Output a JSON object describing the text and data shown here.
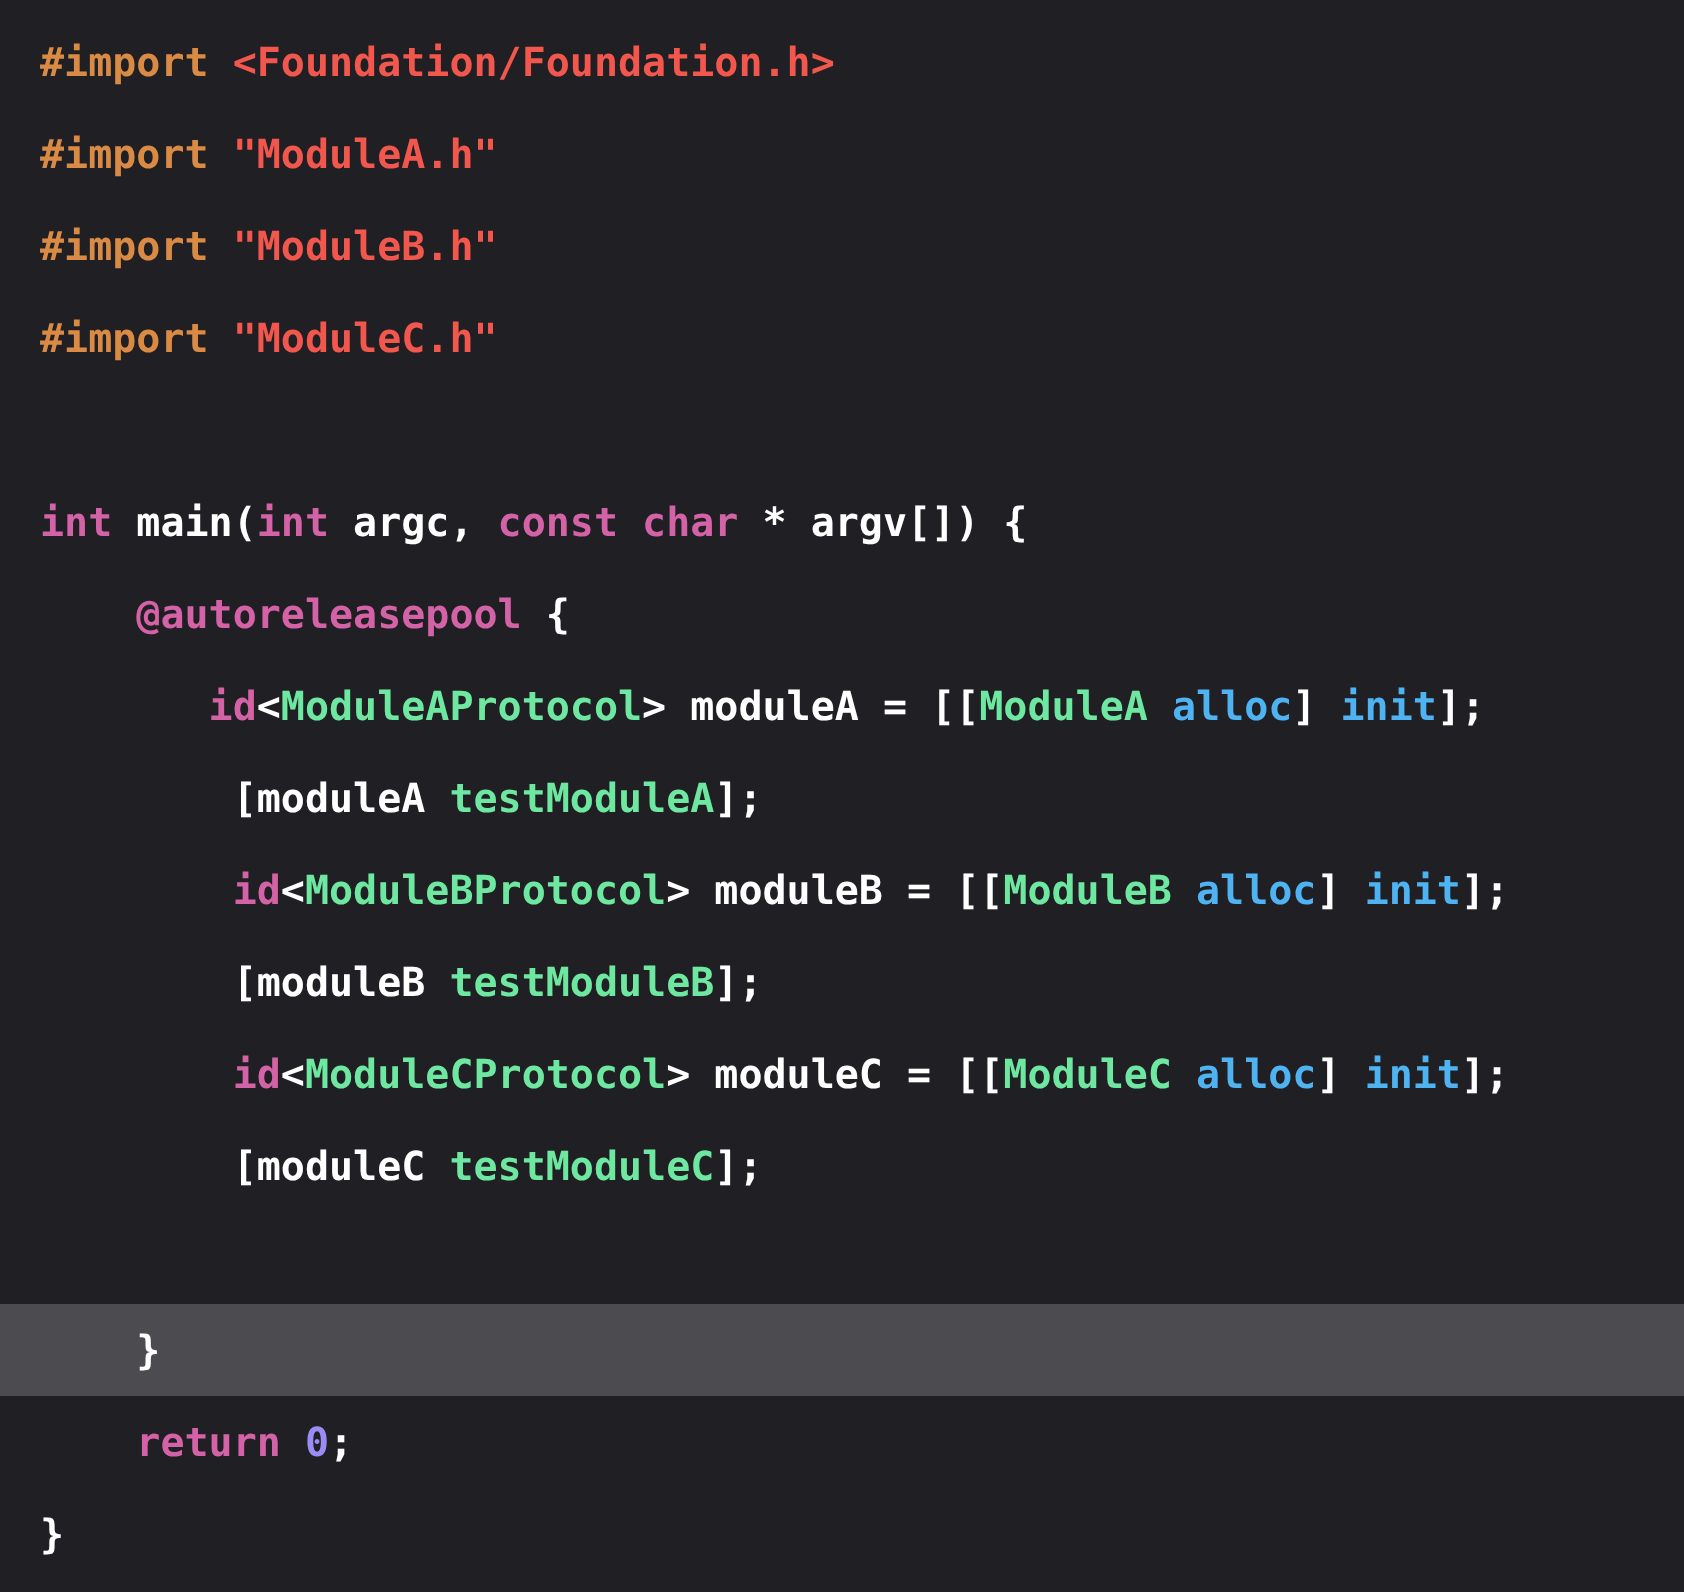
{
  "lines": [
    {
      "kind": "code",
      "highlighted": false,
      "tokens": [
        {
          "kind": "preprocessor",
          "text": "#import "
        },
        {
          "kind": "string",
          "text": "<Foundation/Foundation.h>"
        }
      ]
    },
    {
      "kind": "code",
      "highlighted": false,
      "tokens": [
        {
          "kind": "preprocessor",
          "text": "#import "
        },
        {
          "kind": "string",
          "text": "\"ModuleA.h\""
        }
      ]
    },
    {
      "kind": "code",
      "highlighted": false,
      "tokens": [
        {
          "kind": "preprocessor",
          "text": "#import "
        },
        {
          "kind": "string",
          "text": "\"ModuleB.h\""
        }
      ]
    },
    {
      "kind": "code",
      "highlighted": false,
      "tokens": [
        {
          "kind": "preprocessor",
          "text": "#import "
        },
        {
          "kind": "string",
          "text": "\"ModuleC.h\""
        }
      ]
    },
    {
      "kind": "blank"
    },
    {
      "kind": "code",
      "highlighted": false,
      "tokens": [
        {
          "kind": "keyword",
          "text": "int"
        },
        {
          "kind": "plain",
          "text": " main("
        },
        {
          "kind": "keyword",
          "text": "int"
        },
        {
          "kind": "plain",
          "text": " argc, "
        },
        {
          "kind": "keyword",
          "text": "const char"
        },
        {
          "kind": "plain",
          "text": " * argv[]) {"
        }
      ]
    },
    {
      "kind": "code",
      "highlighted": false,
      "tokens": [
        {
          "kind": "keyword",
          "text": "    @autoreleasepool"
        },
        {
          "kind": "plain",
          "text": " {"
        }
      ]
    },
    {
      "kind": "code",
      "highlighted": false,
      "tokens": [
        {
          "kind": "keyword",
          "text": "       id"
        },
        {
          "kind": "plain",
          "text": "<"
        },
        {
          "kind": "type",
          "text": "ModuleAProtocol"
        },
        {
          "kind": "plain",
          "text": "> moduleA = [["
        },
        {
          "kind": "type",
          "text": "ModuleA "
        },
        {
          "kind": "method",
          "text": "alloc"
        },
        {
          "kind": "plain",
          "text": "] "
        },
        {
          "kind": "method",
          "text": "init"
        },
        {
          "kind": "plain",
          "text": "];"
        }
      ]
    },
    {
      "kind": "code",
      "highlighted": false,
      "tokens": [
        {
          "kind": "plain",
          "text": "        [moduleA "
        },
        {
          "kind": "type",
          "text": "testModuleA"
        },
        {
          "kind": "plain",
          "text": "];"
        }
      ]
    },
    {
      "kind": "code",
      "highlighted": false,
      "tokens": [
        {
          "kind": "keyword",
          "text": "        id"
        },
        {
          "kind": "plain",
          "text": "<"
        },
        {
          "kind": "type",
          "text": "ModuleBProtocol"
        },
        {
          "kind": "plain",
          "text": "> moduleB = [["
        },
        {
          "kind": "type",
          "text": "ModuleB "
        },
        {
          "kind": "method",
          "text": "alloc"
        },
        {
          "kind": "plain",
          "text": "] "
        },
        {
          "kind": "method",
          "text": "init"
        },
        {
          "kind": "plain",
          "text": "];"
        }
      ]
    },
    {
      "kind": "code",
      "highlighted": false,
      "tokens": [
        {
          "kind": "plain",
          "text": "        [moduleB "
        },
        {
          "kind": "type",
          "text": "testModuleB"
        },
        {
          "kind": "plain",
          "text": "];"
        }
      ]
    },
    {
      "kind": "code",
      "highlighted": false,
      "tokens": [
        {
          "kind": "keyword",
          "text": "        id"
        },
        {
          "kind": "plain",
          "text": "<"
        },
        {
          "kind": "type",
          "text": "ModuleCProtocol"
        },
        {
          "kind": "plain",
          "text": "> moduleC = [["
        },
        {
          "kind": "type",
          "text": "ModuleC "
        },
        {
          "kind": "method",
          "text": "alloc"
        },
        {
          "kind": "plain",
          "text": "] "
        },
        {
          "kind": "method",
          "text": "init"
        },
        {
          "kind": "plain",
          "text": "];"
        }
      ]
    },
    {
      "kind": "code",
      "highlighted": false,
      "tokens": [
        {
          "kind": "plain",
          "text": "        [moduleC "
        },
        {
          "kind": "type",
          "text": "testModuleC"
        },
        {
          "kind": "plain",
          "text": "];"
        }
      ]
    },
    {
      "kind": "blank"
    },
    {
      "kind": "code",
      "highlighted": true,
      "tokens": [
        {
          "kind": "plain",
          "text": "    }"
        }
      ]
    },
    {
      "kind": "code",
      "highlighted": false,
      "tokens": [
        {
          "kind": "keyword",
          "text": "    return "
        },
        {
          "kind": "number",
          "text": "0"
        },
        {
          "kind": "plain",
          "text": ";"
        }
      ]
    },
    {
      "kind": "code",
      "highlighted": false,
      "tokens": [
        {
          "kind": "plain",
          "text": "}"
        }
      ]
    }
  ]
}
